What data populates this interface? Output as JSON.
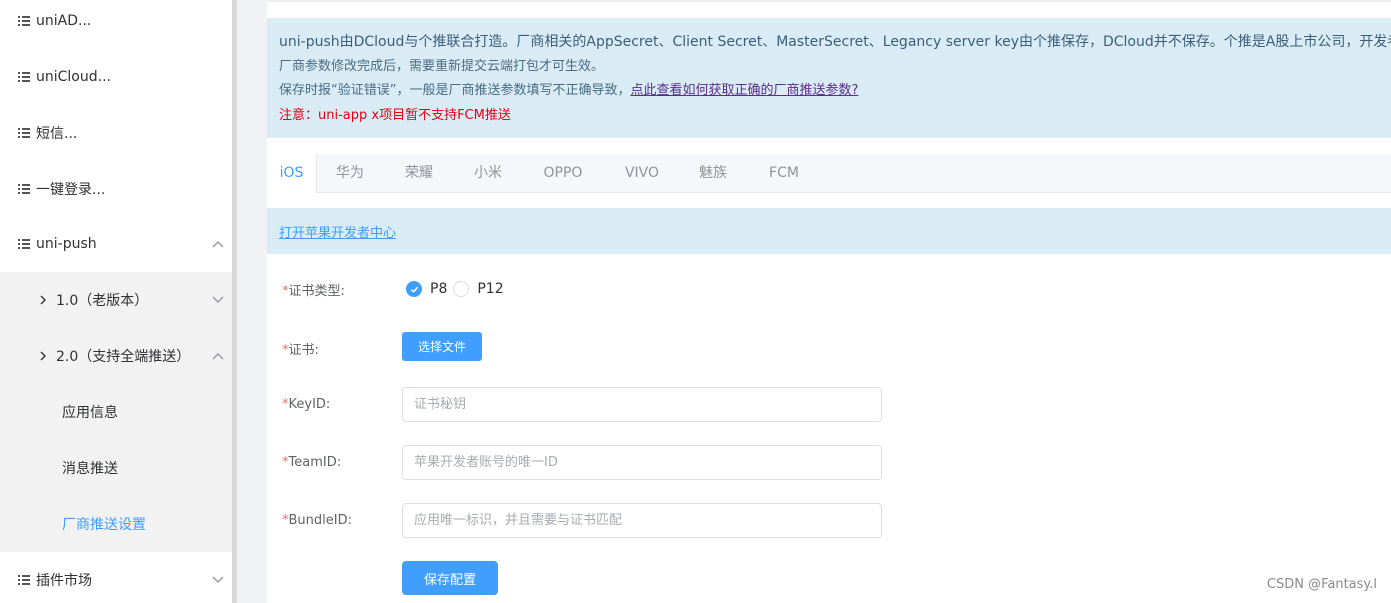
{
  "sidebar": {
    "items": [
      {
        "label": "uniAD..."
      },
      {
        "label": "uniCloud..."
      },
      {
        "label": "短信..."
      },
      {
        "label": "一键登录..."
      },
      {
        "label": "uni-push"
      },
      {
        "label": "1.0（老版本）"
      },
      {
        "label": "2.0（支持全端推送）"
      },
      {
        "label": "应用信息"
      },
      {
        "label": "消息推送"
      },
      {
        "label": "厂商推送设置"
      },
      {
        "label": "插件市场"
      }
    ]
  },
  "notice": {
    "line1": "uni-push由DCloud与个推联合打造。厂商相关的AppSecret、Client Secret、MasterSecret、Legancy server key由个推保存，DCloud并不保存。个推是A股上市公司，开发者可放",
    "line2": "厂商参数修改完成后，需要重新提交云端打包才可生效。",
    "line3_prefix": "保存时报“验证错误”，一般是厂商推送参数填写不正确导致，",
    "line3_link": "点此查看如何获取正确的厂商推送参数?",
    "line4": "注意：uni-app x项目暂不支持FCM推送"
  },
  "tabs": [
    {
      "label": "iOS"
    },
    {
      "label": "华为"
    },
    {
      "label": "荣耀"
    },
    {
      "label": "小米"
    },
    {
      "label": "OPPO"
    },
    {
      "label": "VIVO"
    },
    {
      "label": "魅族"
    },
    {
      "label": "FCM"
    }
  ],
  "devbar": {
    "link": "打开苹果开发者中心"
  },
  "form": {
    "required_mark": "*",
    "cert_type_label": "证书类型:",
    "cert_type_options": [
      "P8",
      "P12"
    ],
    "cert_type_selected": "P8",
    "cert_label": "证书:",
    "choose_file": "选择文件",
    "keyid_label": "KeyID:",
    "keyid_placeholder": "证书秘钥",
    "teamid_label": "TeamID:",
    "teamid_placeholder": "苹果开发者账号的唯一ID",
    "bundleid_label": "BundleID:",
    "bundleid_placeholder": "应用唯一标识，并且需要与证书匹配",
    "save": "保存配置"
  },
  "watermark": "CSDN @Fantasy.l",
  "colors": {
    "accent": "#409eff",
    "notice_bg": "#d9ecf5",
    "warn": "#e60012",
    "required": "#f56c6c",
    "submenu_bg": "#f2f2f2"
  }
}
